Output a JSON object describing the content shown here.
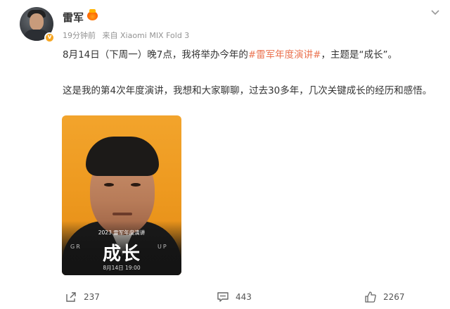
{
  "post": {
    "username": "雷军",
    "time": "19分钟前",
    "source": "来自 Xiaomi MIX Fold 3",
    "line1_before": "8月14日（下周一）晚7点，我将举办今年的",
    "topic": "#雷军年度演讲#",
    "line1_after": "，主题是“成长”。",
    "paragraph2": "这是我的第4次年度演讲，我想和大家聊聊，过去30多年，几次关键成长的经历和感悟。"
  },
  "poster": {
    "subtitle": "2023 雷军年度演讲",
    "title": "成长",
    "grow_left": "GR",
    "grow_right": "UP",
    "date": "8月14日 19:00"
  },
  "actions": {
    "repost_count": "237",
    "comment_count": "443",
    "like_count": "2267"
  },
  "colors": {
    "topic": "#eb7350",
    "poster_bg": "#f2a42c",
    "verified_badge": "#f6a623"
  },
  "icons": [
    "crown-icon",
    "chevron-down-icon",
    "repost-icon",
    "comment-icon",
    "like-icon",
    "verified-badge-icon"
  ]
}
